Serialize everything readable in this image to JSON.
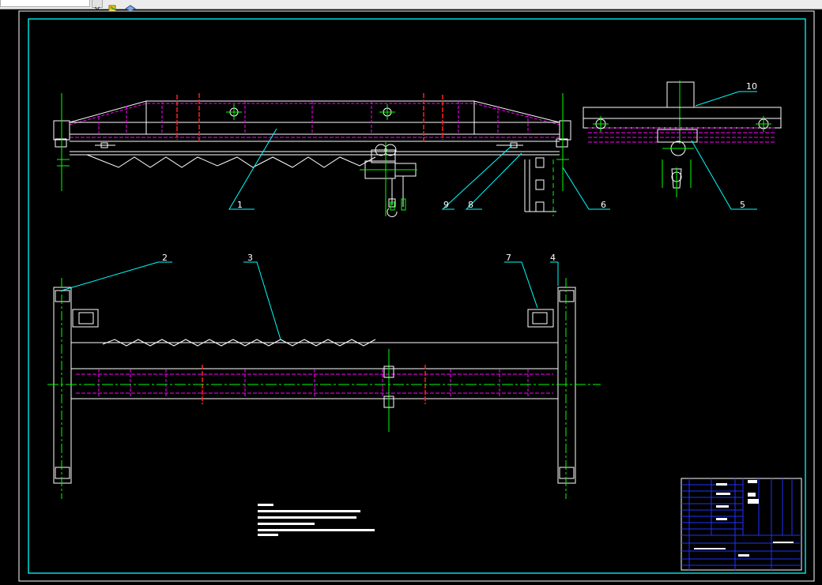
{
  "toolbar": {
    "layer_field_value": "",
    "icons": [
      "layer-state-icon",
      "layer-properties-icon"
    ]
  },
  "drawing": {
    "background": "#000000",
    "colors": {
      "frame": "#ffffff",
      "border": "#00ffff",
      "magenta": "#ff00ff",
      "red": "#ff2020",
      "green": "#00ff00",
      "leader": "#00ffff",
      "white": "#ffffff",
      "blue": "#2030ff"
    },
    "callouts": [
      "1",
      "2",
      "3",
      "4",
      "5",
      "6",
      "7",
      "8",
      "9",
      "10"
    ]
  }
}
